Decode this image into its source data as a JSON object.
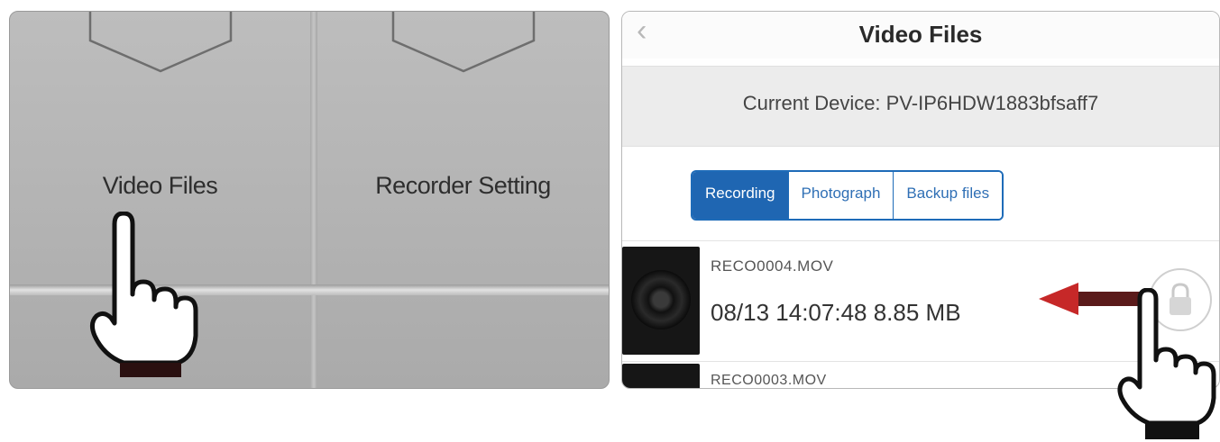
{
  "left_panel": {
    "tiles": [
      {
        "label": "Video Files"
      },
      {
        "label": "Recorder Setting"
      }
    ]
  },
  "right_panel": {
    "nav": {
      "back_icon": "chevron-left-icon",
      "title": "Video Files"
    },
    "device": {
      "text": "Current Device: PV-IP6HDW1883bfsaff7"
    },
    "tabs": [
      {
        "label": "Recording",
        "active": true
      },
      {
        "label": "Photograph",
        "active": false
      },
      {
        "label": "Backup files",
        "active": false
      }
    ],
    "files": [
      {
        "name": "RECO0004.MOV",
        "meta": "08/13 14:07:48  8.85 MB"
      },
      {
        "name": "RECO0003.MOV",
        "meta": ""
      }
    ],
    "colors": {
      "accent": "#1f66b2",
      "arrow": "#c62828"
    }
  }
}
